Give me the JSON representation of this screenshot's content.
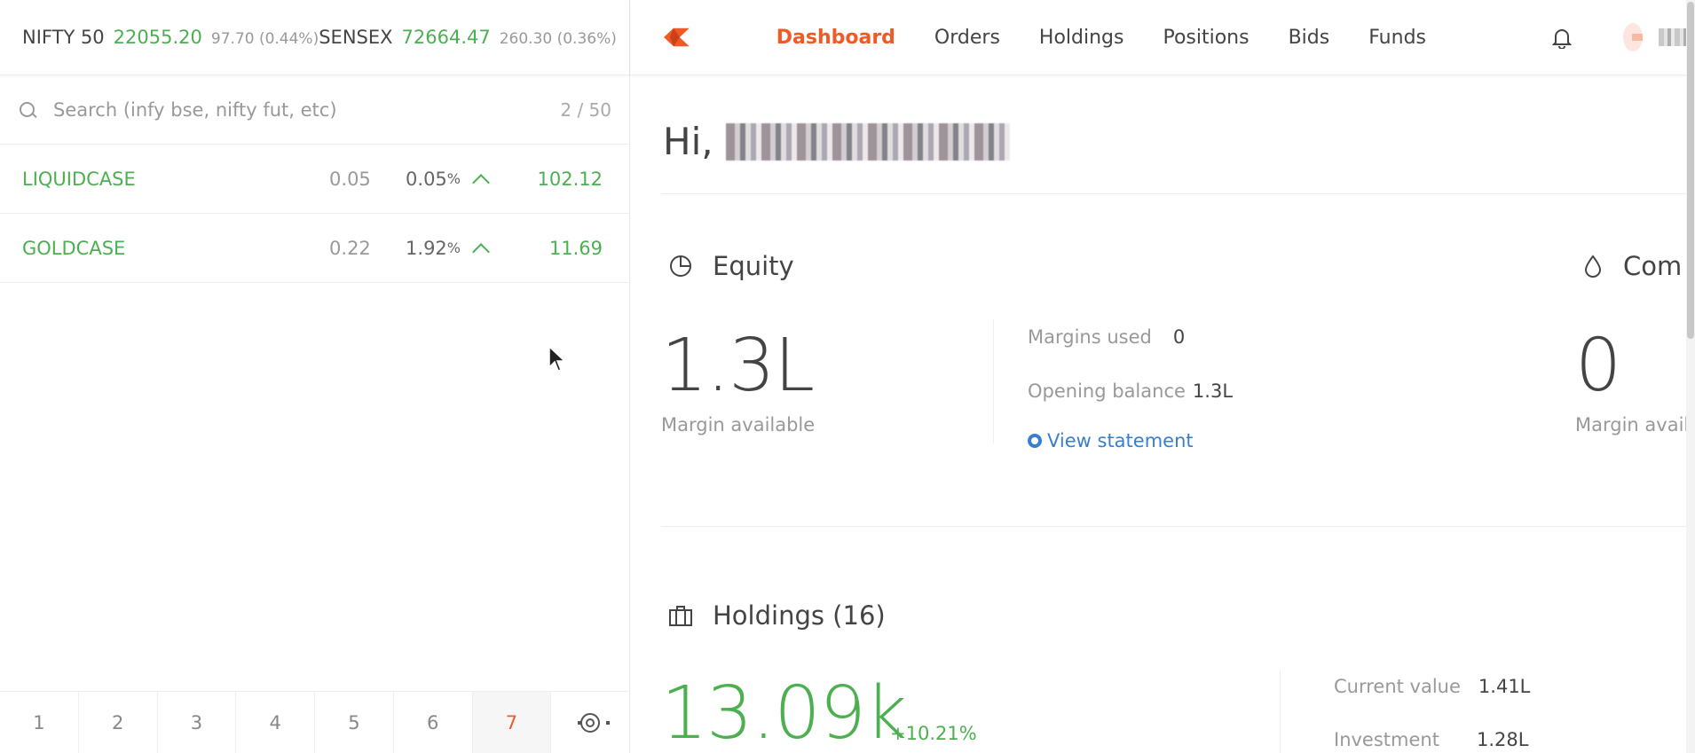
{
  "indices": [
    {
      "name": "NIFTY 50",
      "value": "22055.20",
      "change": "97.70 (0.44%)"
    },
    {
      "name": "SENSEX",
      "value": "72664.47",
      "change": "260.30 (0.36%)"
    }
  ],
  "search": {
    "placeholder": "Search (infy bse, nifty fut, etc)",
    "count": "2 / 50"
  },
  "watchlist": [
    {
      "symbol": "LIQUIDCASE",
      "change": "0.05",
      "pct": "0.05",
      "pct_sign": "%",
      "ltp": "102.12"
    },
    {
      "symbol": "GOLDCASE",
      "change": "0.22",
      "pct": "1.92",
      "pct_sign": "%",
      "ltp": "11.69"
    }
  ],
  "pages": [
    "1",
    "2",
    "3",
    "4",
    "5",
    "6",
    "7"
  ],
  "active_page": "7",
  "nav": {
    "items": [
      "Dashboard",
      "Orders",
      "Holdings",
      "Positions",
      "Bids",
      "Funds"
    ],
    "active": "Dashboard"
  },
  "greeting": {
    "prefix": "Hi,"
  },
  "equity": {
    "title": "Equity",
    "margin_available_value": "1.3L",
    "margin_available_label": "Margin available",
    "margins_used_label": "Margins used",
    "margins_used_value": "0",
    "opening_balance_label": "Opening balance",
    "opening_balance_value": "1.3L",
    "view_statement": "View statement"
  },
  "commodity": {
    "title_partial": "Com",
    "margin_value": "0",
    "margin_label_partial": "Margin avail"
  },
  "holdings": {
    "title": "Holdings (16)",
    "pnl_value": "13.09k",
    "pnl_pct": "+10.21%",
    "current_value_label": "Current value",
    "current_value": "1.41L",
    "investment_label": "Investment",
    "investment_value": "1.28L"
  },
  "colors": {
    "accent": "#f05a24",
    "positive": "#4caf50",
    "link": "#387ed1"
  },
  "icons": [
    "search-icon",
    "caret-up-icon",
    "gear-icon",
    "kite-logo-icon",
    "bell-icon",
    "pie-chart-icon",
    "drop-icon",
    "briefcase-icon"
  ]
}
